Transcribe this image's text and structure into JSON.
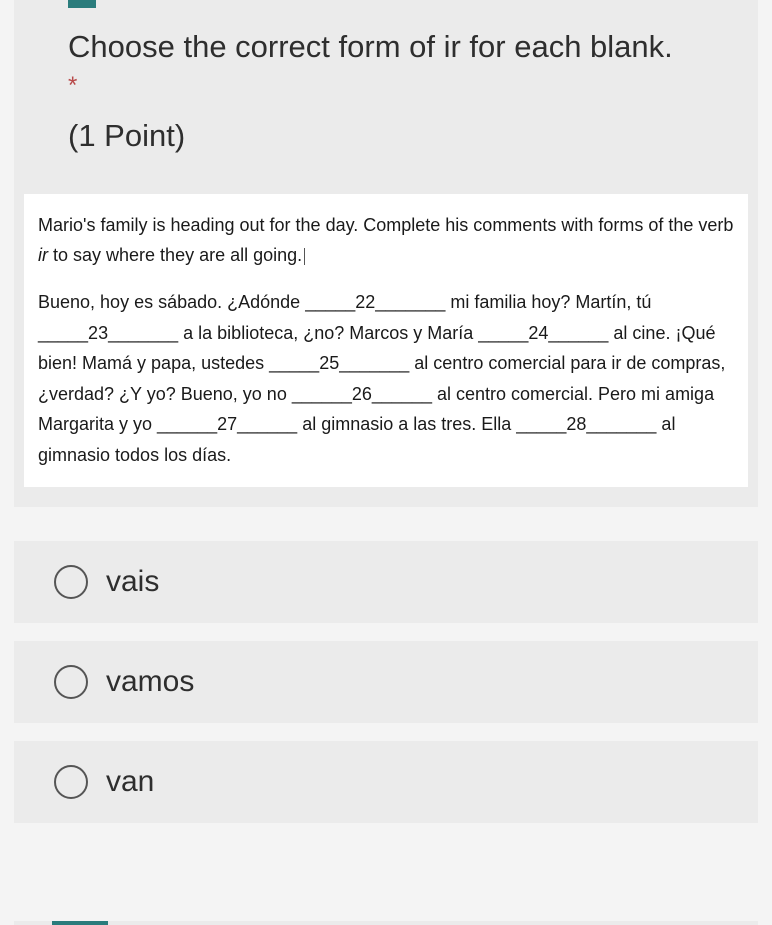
{
  "question": {
    "title": "Choose the correct form of ir for each blank.",
    "required_marker": "*",
    "points_label": "(1 Point)"
  },
  "passage": {
    "intro_pre": "Mario's family is heading out for the day.  Complete his comments with forms of the verb ",
    "intro_verb": "ir",
    "intro_post": " to say where they are all going.",
    "body": "Bueno, hoy es sábado.  ¿Adónde _____22_______ mi familia hoy?  Martín, tú _____23_______ a la biblioteca, ¿no?  Marcos y María _____24______ al cine.  ¡Qué bien!  Mamá y papa, ustedes _____25_______ al centro comercial para ir de compras, ¿verdad?  ¿Y yo?  Bueno, yo no ______26______ al centro comercial.  Pero mi amiga Margarita y yo ______27______ al gimnasio a las tres.  Ella _____28_______ al gimnasio todos los días."
  },
  "options": [
    {
      "label": "vais"
    },
    {
      "label": "vamos"
    },
    {
      "label": "van"
    }
  ]
}
